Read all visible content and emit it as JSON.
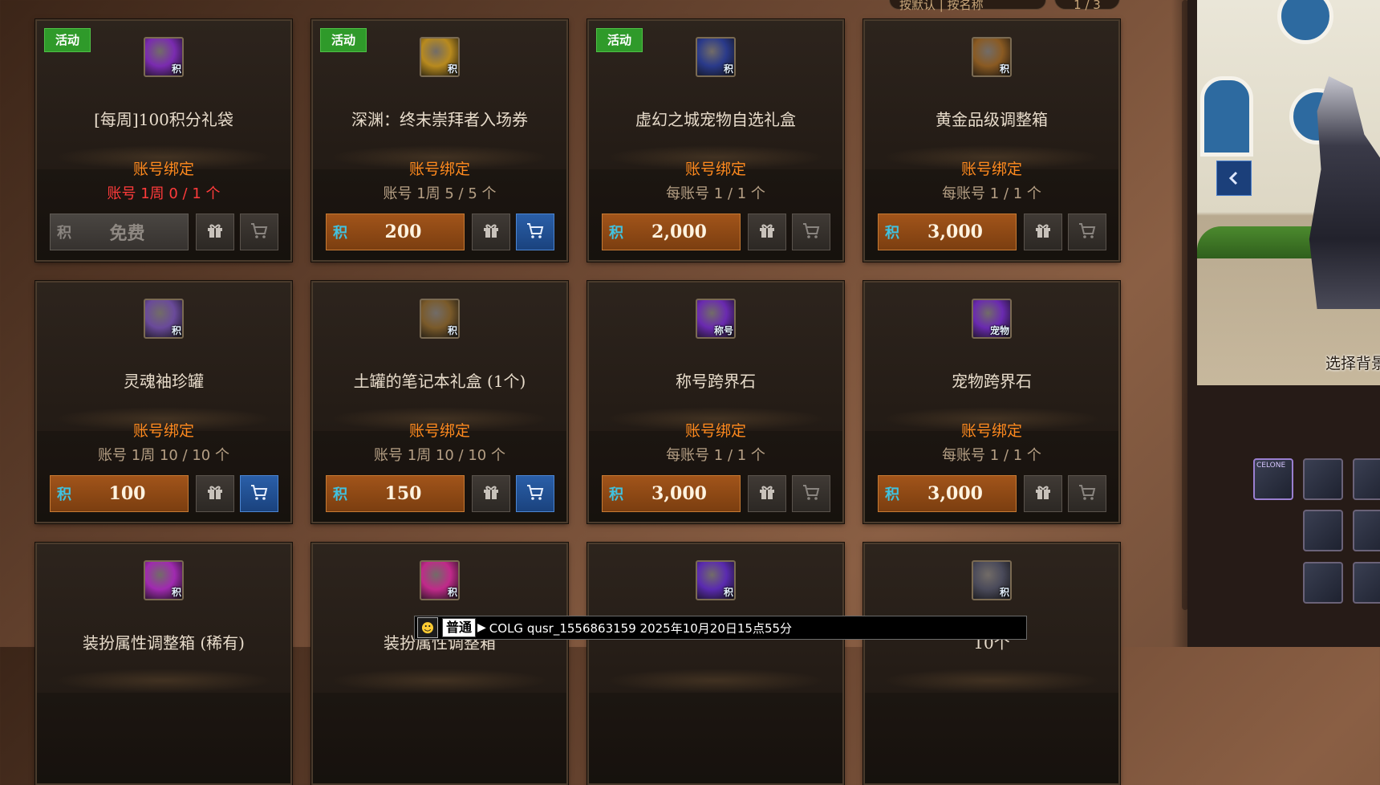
{
  "header": {
    "sort_label": "按默认 | 按名称",
    "page_label": "1 / 3"
  },
  "currency_symbol": "积",
  "products": [
    {
      "tag": "活动",
      "name": "[每周]100积分礼袋",
      "bind": "账号绑定",
      "limit": "账号 1周 0 / 1 个",
      "limit_red": true,
      "price": "免费",
      "disabled": true,
      "cart_active": false,
      "icon_color": "#7a2bb0",
      "icon_badge": "积"
    },
    {
      "tag": "活动",
      "name": "深渊：终末崇拜者入场券",
      "bind": "账号绑定",
      "limit": "账号 1周 5 / 5 个",
      "price": "200",
      "cart_active": true,
      "icon_color": "#b88a1e",
      "icon_badge": "积"
    },
    {
      "tag": "活动",
      "name": "虚幻之城宠物自选礼盒",
      "bind": "账号绑定",
      "limit": "每账号 1 / 1 个",
      "price": "2,000",
      "cart_active": false,
      "icon_color": "#2a3a8a",
      "icon_badge": "积"
    },
    {
      "tag": "",
      "name": "黄金品级调整箱",
      "bind": "账号绑定",
      "limit": "每账号 1 / 1 个",
      "price": "3,000",
      "cart_active": false,
      "icon_color": "#8a5a22",
      "icon_badge": "积"
    },
    {
      "tag": "",
      "name": "灵魂袖珍罐",
      "bind": "账号绑定",
      "limit": "账号 1周 10 / 10 个",
      "price": "100",
      "cart_active": true,
      "icon_color": "#6a4a9a",
      "icon_badge": "积"
    },
    {
      "tag": "",
      "name": "土罐的笔记本礼盒 (1个)",
      "bind": "账号绑定",
      "limit": "账号 1周 10 / 10 个",
      "price": "150",
      "cart_active": true,
      "icon_color": "#7a5a2a",
      "icon_badge": "积"
    },
    {
      "tag": "",
      "name": "称号跨界石",
      "bind": "账号绑定",
      "limit": "每账号 1 / 1 个",
      "price": "3,000",
      "cart_active": false,
      "icon_color": "#6a2ab0",
      "icon_badge": "称号"
    },
    {
      "tag": "",
      "name": "宠物跨界石",
      "bind": "账号绑定",
      "limit": "每账号 1 / 1 个",
      "price": "3,000",
      "cart_active": false,
      "icon_color": "#6a2ab0",
      "icon_badge": "宠物"
    },
    {
      "tag": "",
      "name": "装扮属性调整箱 (稀有)",
      "icon_color": "#a02ab0",
      "icon_badge": "积"
    },
    {
      "tag": "",
      "name": "装扮属性调整箱",
      "icon_color": "#c02a8a",
      "icon_badge": "积"
    },
    {
      "tag": "",
      "name": "",
      "icon_color": "#5a2ab0",
      "icon_badge": "积"
    },
    {
      "tag": "",
      "name": "10个",
      "icon_color": "#4a4a5a",
      "icon_badge": "积"
    }
  ],
  "side": {
    "scene_label": "选择背景",
    "thumb_label": "CELONE"
  },
  "chat": {
    "channel": "普通",
    "message": "COLG qusr_1556863159 2025年10月20日15点55分"
  },
  "colors": {
    "bind": "#ff8a1e",
    "tag_bg": "#2f9a2a",
    "cart_active": "#2a5fa8",
    "price_btn": "#a1541a"
  }
}
